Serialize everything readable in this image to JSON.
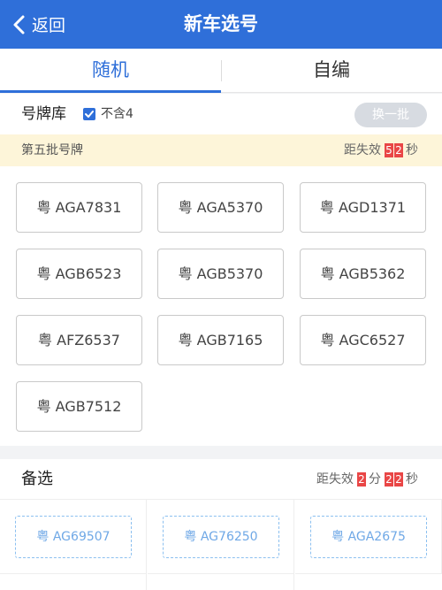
{
  "header": {
    "back_label": "返回",
    "title": "新车选号"
  },
  "tabs": [
    {
      "label": "随机",
      "active": true
    },
    {
      "label": "自编",
      "active": false
    }
  ],
  "library": {
    "title": "号牌库",
    "checkbox_label": "不含4",
    "checkbox_checked": true,
    "swap_label": "换一批"
  },
  "batch": {
    "title": "第五批号牌",
    "expire_label": "距失效",
    "digits": [
      "5",
      "2"
    ],
    "unit": "秒"
  },
  "plates": [
    "粤 AGA7831",
    "粤 AGA5370",
    "粤 AGD1371",
    "粤 AGB6523",
    "粤 AGB5370",
    "粤 AGB5362",
    "粤 AFZ6537",
    "粤 AGB7165",
    "粤 AGC6527",
    "粤 AGB7512"
  ],
  "alternates": {
    "title": "备选",
    "expire_label": "距失效",
    "minutes": [
      "2"
    ],
    "minutes_unit": "分",
    "seconds": [
      "2",
      "2"
    ],
    "seconds_unit": "秒",
    "items": [
      "粤 AG69507",
      "粤 AG76250",
      "粤 AGA2675"
    ]
  },
  "colors": {
    "primary": "#2f6fd9",
    "countdown_digit": "#e94646",
    "banner_bg": "#fdf5d9",
    "alt_border": "#8cc0f0"
  }
}
